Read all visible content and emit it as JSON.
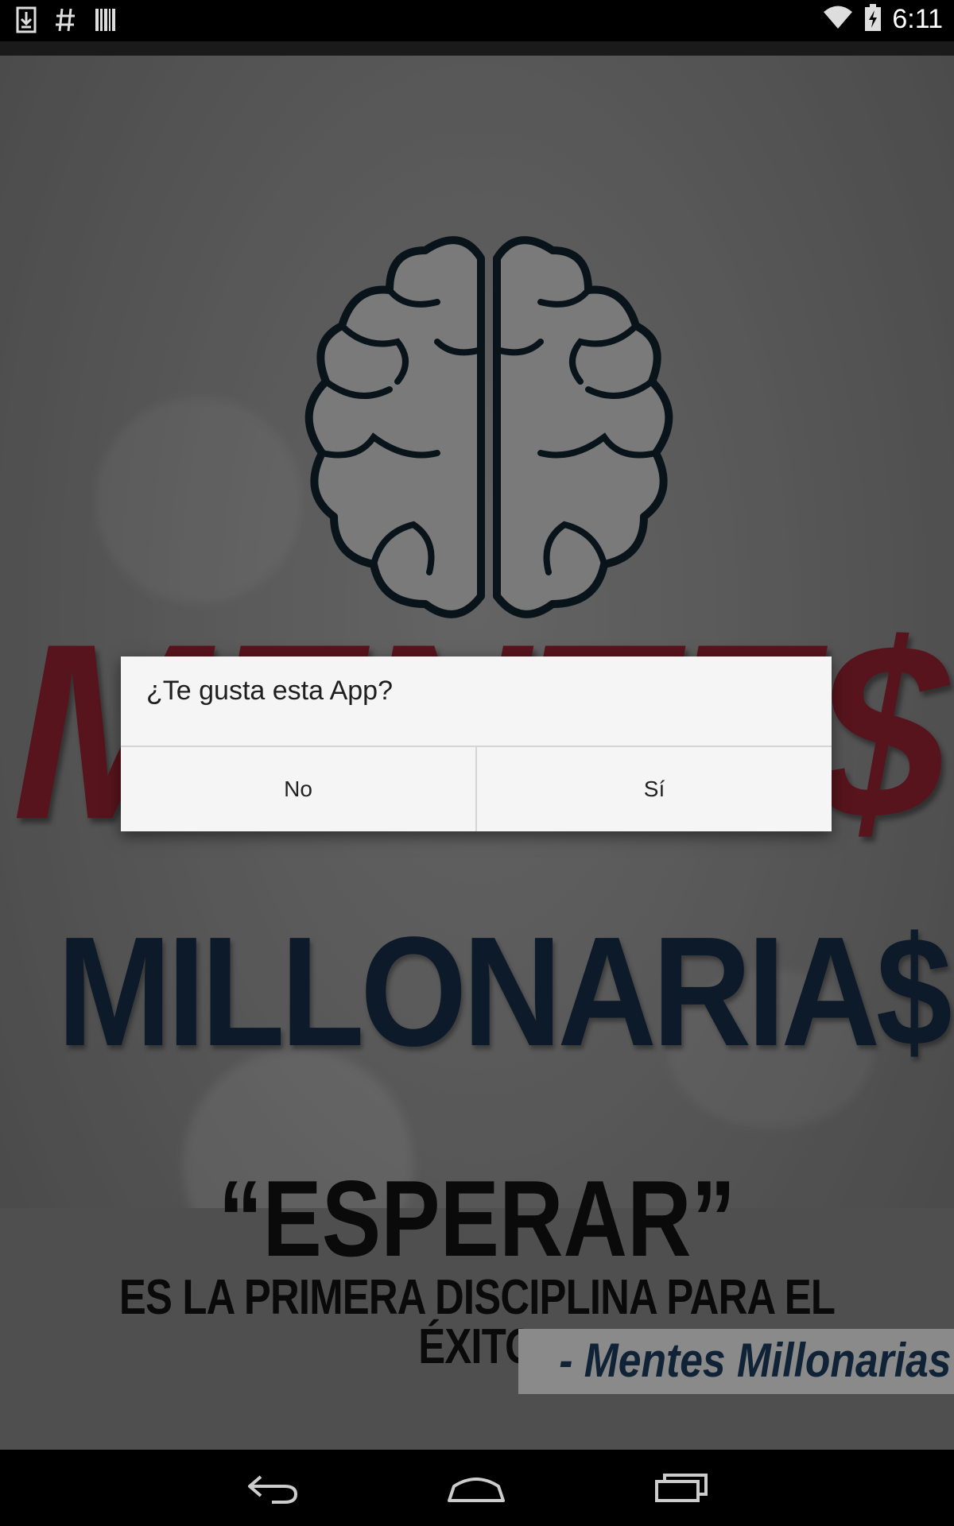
{
  "status_bar": {
    "time": "6:11",
    "left_icons": [
      "download-icon",
      "hash-icon",
      "barcode-icon"
    ],
    "right_icons": [
      "wifi-icon",
      "battery-charging-icon"
    ]
  },
  "background": {
    "brand_title": "MENTE$",
    "brand_subtitle": "MILLONARIA$",
    "quote_main": "“ESPERAR”",
    "quote_sub": "ES LA PRIMERA  DISCIPLINA  PARA EL ÉXITO",
    "quote_author": "- Mentes Millonarias"
  },
  "dialog": {
    "title": "¿Te gusta esta App?",
    "no_label": "No",
    "yes_label": "Sí"
  },
  "nav_bar": {
    "icons": [
      "back-icon",
      "home-icon",
      "recents-icon"
    ]
  },
  "colors": {
    "brand_red": "#7a1c28",
    "brand_navy": "#11253a",
    "dialog_bg": "#f5f5f5"
  }
}
